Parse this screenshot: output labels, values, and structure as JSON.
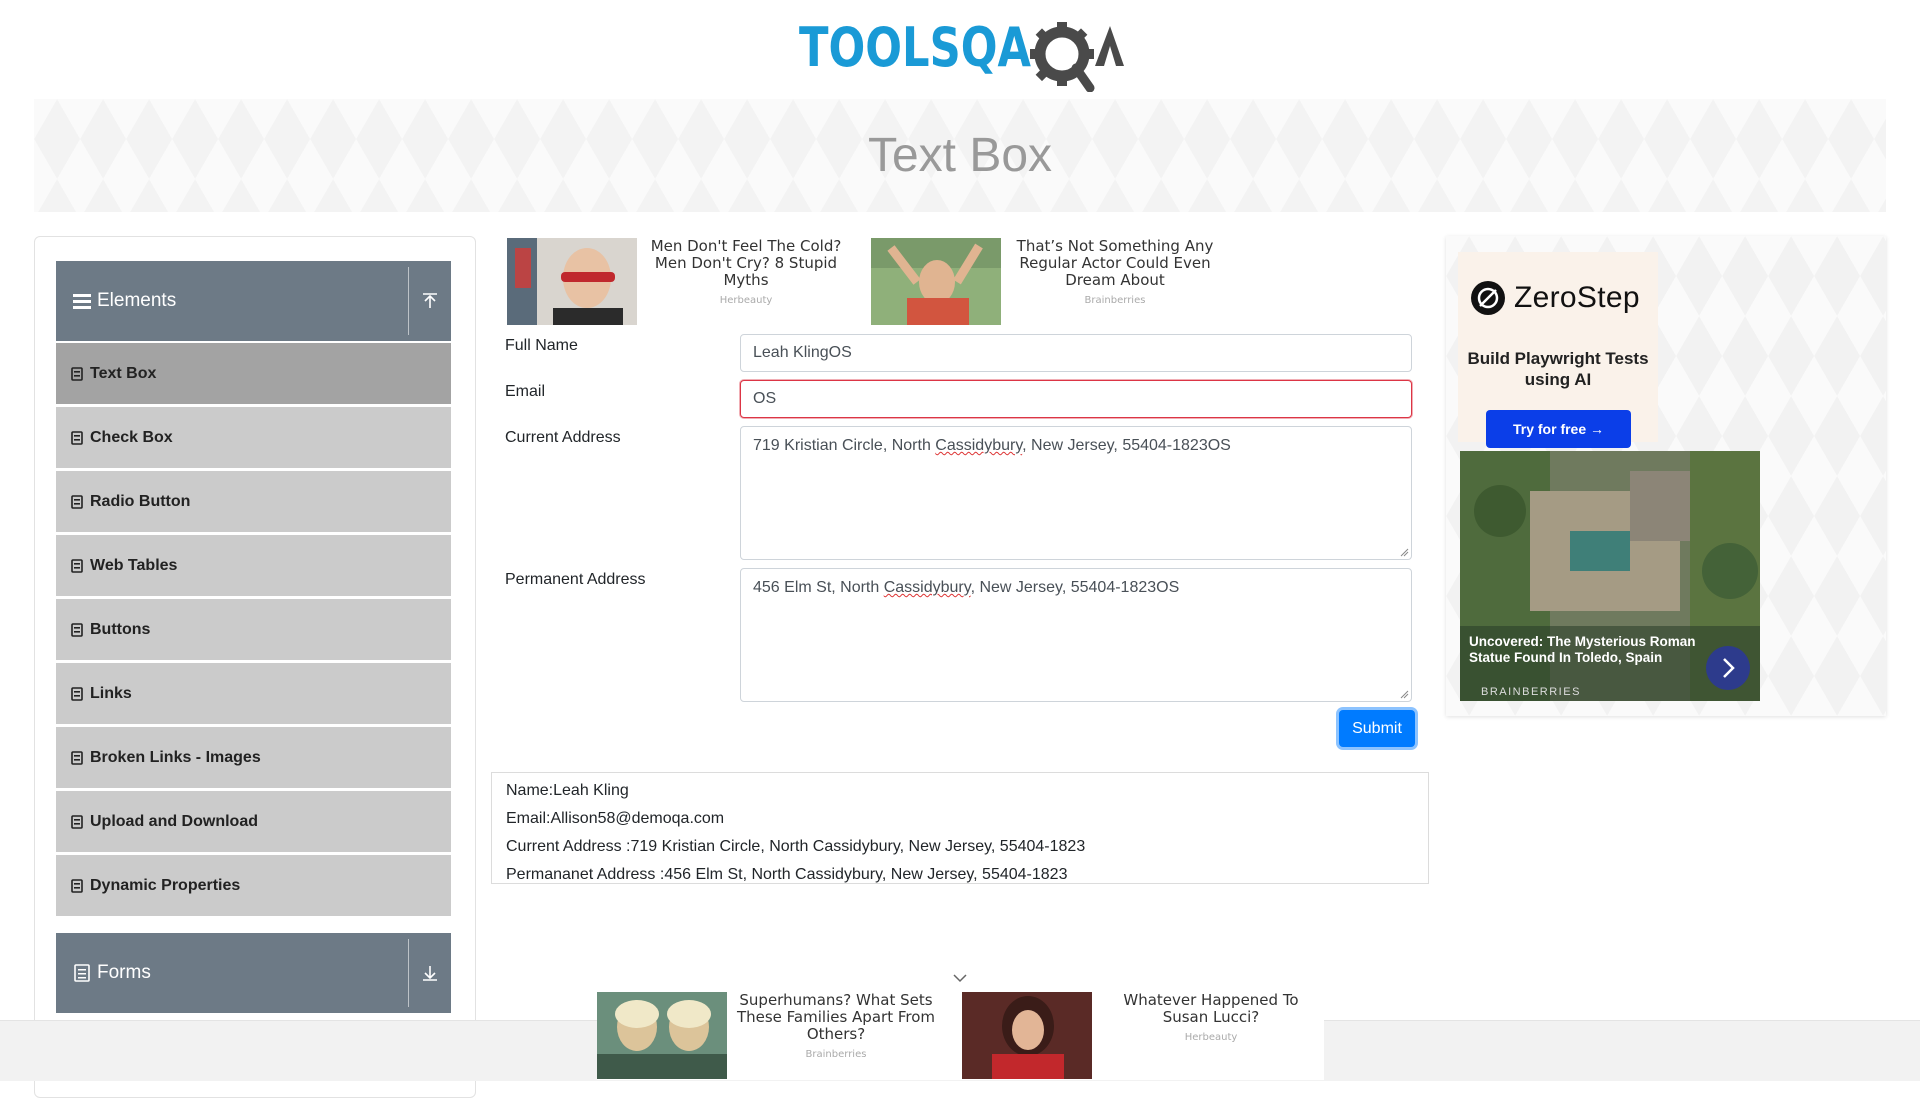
{
  "header": {
    "logo_text": "TOOLSQA",
    "page_title": "Text Box"
  },
  "sidebar": {
    "group_elements": "Elements",
    "items": [
      {
        "label": "Text Box",
        "active": true
      },
      {
        "label": "Check Box"
      },
      {
        "label": "Radio Button"
      },
      {
        "label": "Web Tables"
      },
      {
        "label": "Buttons"
      },
      {
        "label": "Links"
      },
      {
        "label": "Broken Links - Images"
      },
      {
        "label": "Upload and Download"
      },
      {
        "label": "Dynamic Properties"
      }
    ],
    "group_forms": "Forms"
  },
  "top_ads": [
    {
      "title": "Men Don't Feel The Cold? Men Don't Cry? 8 Stupid Myths",
      "source": "Herbeauty"
    },
    {
      "title": "That’s Not Something Any Regular Actor Could Even Dream About",
      "source": "Brainberries"
    }
  ],
  "form": {
    "full_name_label": "Full Name",
    "full_name_value": "Leah KlingOS",
    "email_label": "Email",
    "email_value": "OS",
    "current_address_label": "Current Address",
    "current_address_value": {
      "before": "719 Kristian Circle, North ",
      "flagged": "Cassidybury",
      "after": ", New Jersey, 55404-1823OS"
    },
    "permanent_address_label": "Permanent Address",
    "permanent_address_value": {
      "before": "456 Elm St, North ",
      "flagged": "Cassidybury",
      "after": ", New Jersey, 55404-1823OS"
    },
    "submit_label": "Submit"
  },
  "output": {
    "name": "Name:Leah Kling",
    "email": "Email:Allison58@demoqa.com",
    "current_address": "Current Address :719 Kristian Circle, North Cassidybury, New Jersey, 55404-1823",
    "permanent_address": "Permananet Address :456 Elm St, North Cassidybury, New Jersey, 55404-1823"
  },
  "right_ad": {
    "brand": "ZeroStep",
    "tagline": "Build Playwright Tests using AI",
    "cta": "Try for free →",
    "story_title": "Uncovered: The Mysterious Roman Statue Found In Toledo, Spain",
    "story_source": "BRAINBERRIES"
  },
  "bottom_ads": [
    {
      "title": "Superhumans? What Sets These Families Apart From Others?",
      "source": "Brainberries"
    },
    {
      "title": "Whatever Happened To Susan Lucci?",
      "source": "Herbeauty"
    }
  ],
  "colors": {
    "sidebar_header": "#6d7a86",
    "menu_item": "#cbcbcb",
    "menu_item_active": "#a3a3a3",
    "primary": "#007bff",
    "invalid": "#dc3545",
    "logo_blue": "#1a9ad6",
    "logo_dark": "#4a4a4a"
  }
}
